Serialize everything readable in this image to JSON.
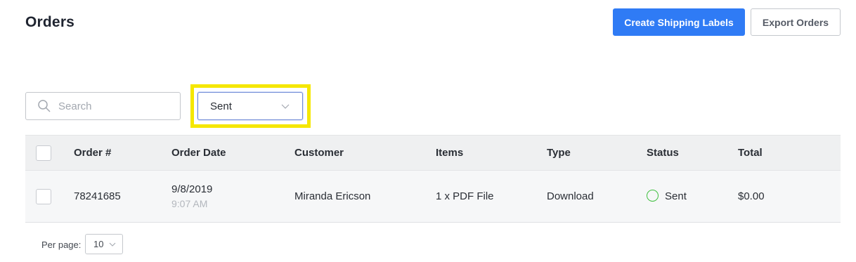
{
  "page": {
    "title": "Orders"
  },
  "toolbar": {
    "create_labels": "Create Shipping Labels",
    "export_orders": "Export Orders"
  },
  "filters": {
    "search_placeholder": "Search",
    "status_value": "Sent"
  },
  "table": {
    "columns": [
      "Order #",
      "Order Date",
      "Customer",
      "Items",
      "Type",
      "Status",
      "Total"
    ],
    "rows": [
      {
        "order": "78241685",
        "date": "9/8/2019",
        "time": "9:07 AM",
        "customer": "Miranda Ericson",
        "items": "1 x PDF File",
        "type": "Download",
        "status": "Sent",
        "total": "$0.00"
      }
    ]
  },
  "pagination": {
    "per_page_label": "Per page:",
    "per_page_value": "10"
  },
  "colors": {
    "primary": "#2f7bf5",
    "status_sent": "#3fbf3f",
    "highlight": "#f5e700"
  }
}
